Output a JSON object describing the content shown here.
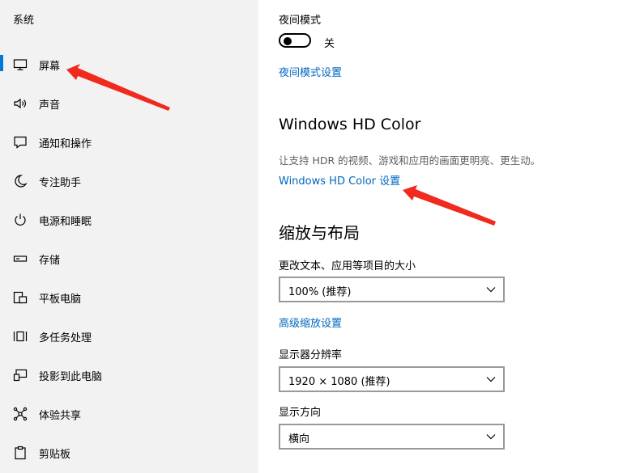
{
  "sidebar": {
    "title": "系统",
    "items": [
      {
        "label": "屏幕",
        "icon": "monitor-icon",
        "selected": true
      },
      {
        "label": "声音",
        "icon": "speaker-icon"
      },
      {
        "label": "通知和操作",
        "icon": "notification-icon"
      },
      {
        "label": "专注助手",
        "icon": "moon-icon"
      },
      {
        "label": "电源和睡眠",
        "icon": "power-icon"
      },
      {
        "label": "存储",
        "icon": "storage-icon"
      },
      {
        "label": "平板电脑",
        "icon": "tablet-icon"
      },
      {
        "label": "多任务处理",
        "icon": "multitasking-icon"
      },
      {
        "label": "投影到此电脑",
        "icon": "projection-icon"
      },
      {
        "label": "体验共享",
        "icon": "share-icon"
      },
      {
        "label": "剪贴板",
        "icon": "clipboard-icon"
      }
    ]
  },
  "night_light": {
    "label": "夜间模式",
    "toggle_state": "关",
    "settings_link": "夜间模式设置"
  },
  "hd_color": {
    "heading": "Windows HD Color",
    "description": "让支持 HDR 的视频、游戏和应用的画面更明亮、更生动。",
    "settings_link": "Windows HD Color 设置"
  },
  "scale_layout": {
    "heading": "缩放与布局",
    "scale_label": "更改文本、应用等项目的大小",
    "scale_value": "100% (推荐)",
    "advanced_link": "高级缩放设置",
    "resolution_label": "显示器分辨率",
    "resolution_value": "1920 × 1080 (推荐)",
    "orientation_label": "显示方向",
    "orientation_value": "横向"
  },
  "colors": {
    "accent": "#0078d4",
    "link": "#0067c0",
    "annotation_arrow": "#f02a1e"
  }
}
